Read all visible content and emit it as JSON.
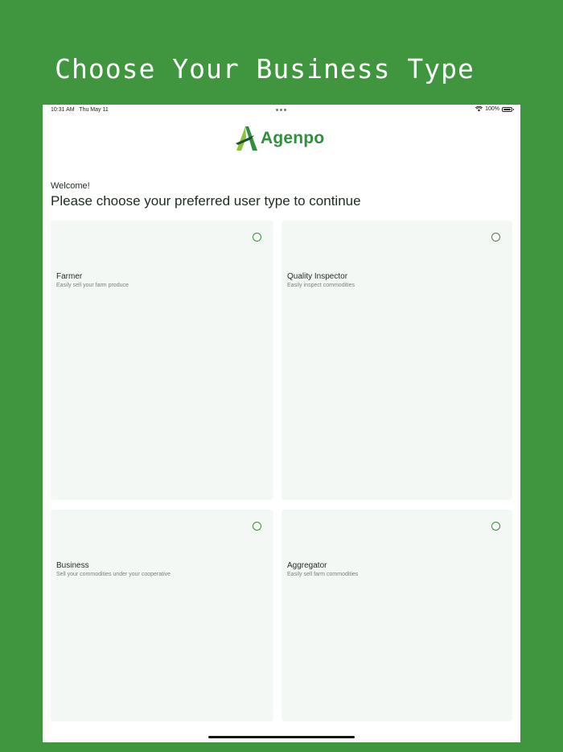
{
  "hero": {
    "title": "Choose Your Business Type"
  },
  "status_bar": {
    "time": "10:31 AM",
    "date": "Thu May 11",
    "battery": "100%",
    "icons": [
      "wifi-icon",
      "battery-icon"
    ]
  },
  "brand": {
    "name": "Agenpo",
    "color": "#2e8f3e",
    "accent": "#8ac43f"
  },
  "screen": {
    "welcome": "Welcome!",
    "prompt": "Please choose your preferred user type to continue"
  },
  "user_types": [
    {
      "title": "Farmer",
      "subtitle": "Easily sell your farm produce",
      "selected": false
    },
    {
      "title": "Quality Inspector",
      "subtitle": "Easily inspect commodities",
      "selected": false
    },
    {
      "title": "Business",
      "subtitle": "Sell your commodities under your cooperative",
      "selected": false
    },
    {
      "title": "Aggregator",
      "subtitle": "Easily sell farm commodities",
      "selected": false
    }
  ],
  "colors": {
    "background": "#3f963f",
    "card": "#f4f8f4",
    "radio": "#3a8a3a"
  }
}
